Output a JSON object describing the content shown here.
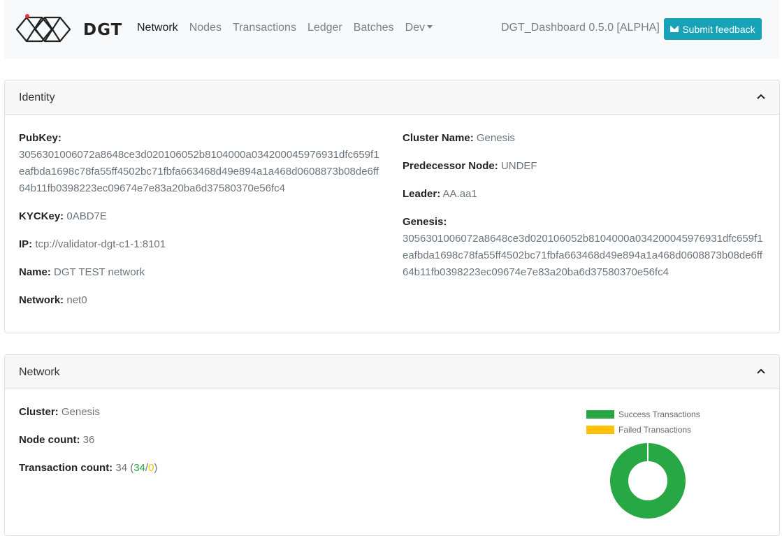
{
  "navbar": {
    "brand": "DGT",
    "links": [
      {
        "label": "Network",
        "active": true
      },
      {
        "label": "Nodes"
      },
      {
        "label": "Transactions"
      },
      {
        "label": "Ledger"
      },
      {
        "label": "Batches"
      },
      {
        "label": "Dev"
      }
    ],
    "version": "DGT_Dashboard 0.5.0 [ALPHA]",
    "feedback_label": "Submit feedback",
    "feedback_color": "#17a2b8"
  },
  "identity": {
    "title": "Identity",
    "pubkey_label": "PubKey:",
    "pubkey": "3056301006072a8648ce3d020106052b8104000a034200045976931dfc659f1eafbda1698c78fa55ff4502bc71fbfa663468d49e894a1a468d0608873b08de6ff64b11fb0398223ec09674e7e83a20ba6d37580370e56fc4",
    "kyckey_label": "KYCKey:",
    "kyckey": "0ABD7E",
    "ip_label": "IP:",
    "ip": "tcp://validator-dgt-c1-1:8101",
    "name_label": "Name:",
    "name": "DGT TEST network",
    "network_label": "Network:",
    "network": "net0",
    "cluster_name_label": "Cluster Name:",
    "cluster_name": "Genesis",
    "predecessor_label": "Predecessor Node:",
    "predecessor": "UNDEF",
    "leader_label": "Leader:",
    "leader": "AA.aa1",
    "genesis_label": "Genesis:",
    "genesis": "3056301006072a8648ce3d020106052b8104000a034200045976931dfc659f1eafbda1698c78fa55ff4502bc71fbfa663468d49e894a1a468d0608873b08de6ff64b11fb0398223ec09674e7e83a20ba6d37580370e56fc4"
  },
  "network": {
    "title": "Network",
    "cluster_label": "Cluster:",
    "cluster": "Genesis",
    "node_count_label": "Node count:",
    "node_count": "36",
    "tx_count_label": "Transaction count:",
    "tx_total": "34",
    "tx_success": "34",
    "tx_failed": "0",
    "tx_open": "(",
    "tx_slash": "/",
    "tx_close": ")"
  },
  "chart_data": {
    "type": "pie",
    "categories": [
      "Success Transactions",
      "Failed Transactions"
    ],
    "values": [
      34,
      0
    ],
    "colors": [
      "#28a745",
      "#ffc107"
    ],
    "legend": "top"
  }
}
